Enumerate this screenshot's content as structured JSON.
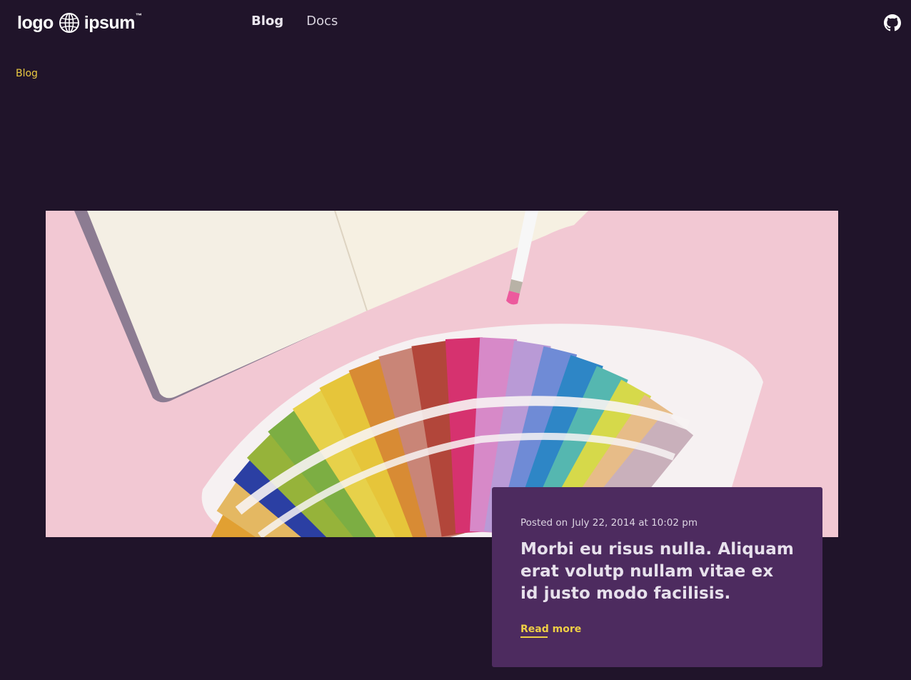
{
  "header": {
    "logo": {
      "left": "logo",
      "right": "ipsum",
      "tm": "™"
    },
    "nav": [
      {
        "label": "Blog",
        "active": true
      },
      {
        "label": "Docs",
        "active": false
      }
    ],
    "github_icon": "github-icon"
  },
  "breadcrumb": {
    "label": "Blog"
  },
  "post": {
    "posted_prefix": "Posted on",
    "date": "July 22, 2014 at 10:02 pm",
    "title": "Morbi eu risus nulla. Aliquam erat volutp nullam vitae ex id justo modo facilisis.",
    "read_more": "Read more"
  },
  "colors": {
    "background": "#20142a",
    "card": "#4d2b5f",
    "accent": "#efcf45",
    "hero_background": "#f2c9d4"
  }
}
